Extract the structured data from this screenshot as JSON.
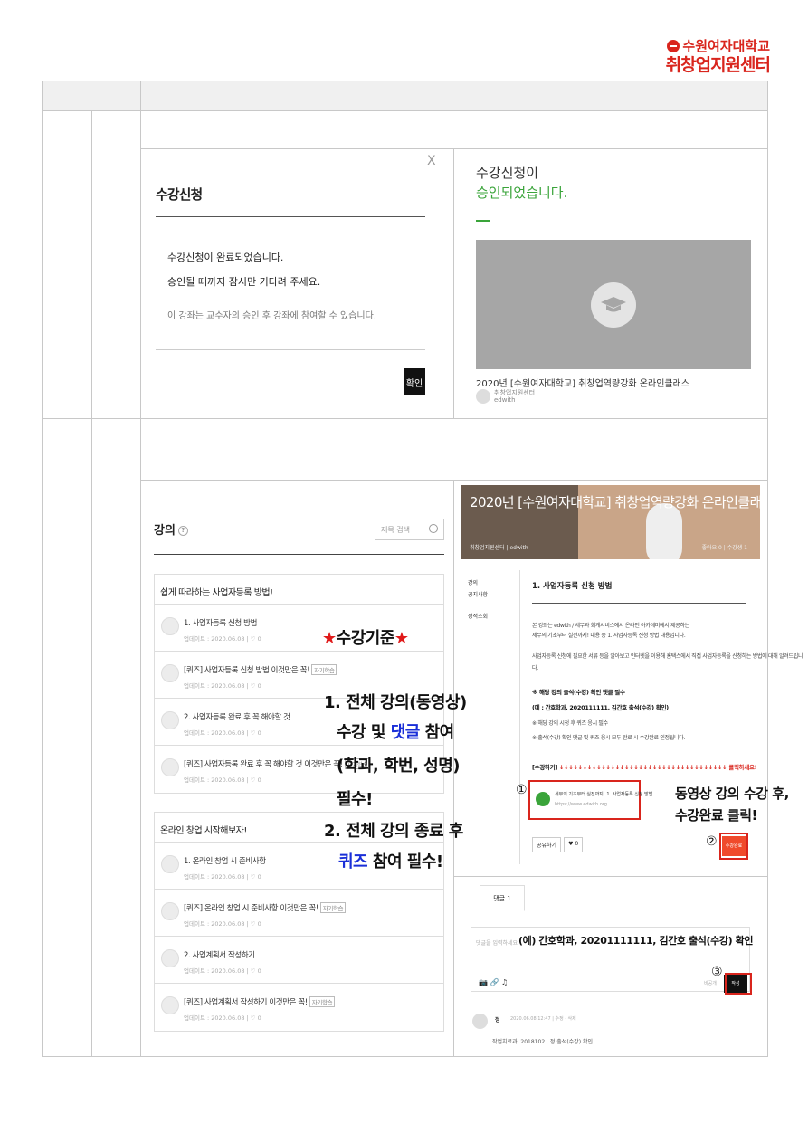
{
  "logo": {
    "line1": "수원여자대학교",
    "line2": "취창업지원센터"
  },
  "panel1_left": {
    "close": "X",
    "title": "수강신청",
    "msg1": "수강신청이 완료되었습니다.",
    "msg2": "승인될 때까지 잠시만 기다려 주세요.",
    "note": "이 강좌는 교수자의 승인 후 강좌에 참여할 수 있습니다.",
    "confirm": "확인"
  },
  "panel1_right": {
    "line1": "수강신청이",
    "line2": "승인되었습니다.",
    "course_title": "2020년 [수원여자대학교] 취창업역량강화 온라인클래스",
    "author": "취창업지원센터",
    "author_sub": "edwith"
  },
  "lectures": {
    "heading": "강의",
    "help": "?",
    "search_placeholder": "제목 검색",
    "sections": [
      {
        "title": "쉽게 따라하는 사업자등록 방법!",
        "items": [
          {
            "title": "1. 사업자등록 신청 방법",
            "tag": "",
            "date": "업데이트 : 2020.06.08  |  ♡ 0"
          },
          {
            "title": "[퀴즈] 사업자등록 신청 방법 이것만은 꼭!",
            "tag": "자기학습",
            "date": "업데이트 : 2020.06.08  |  ♡ 0"
          },
          {
            "title": "2. 사업자등록 완료 후 꼭 해야할 것",
            "tag": "",
            "date": "업데이트 : 2020.06.08  |  ♡ 0"
          },
          {
            "title": "[퀴즈] 사업자등록 완료 후 꼭 해야할 것 이것만은 꼭!",
            "tag": "자기학습",
            "date": "업데이트 : 2020.06.08  |  ♡ 0"
          }
        ]
      },
      {
        "title": "온라인 창업 시작해보자!",
        "items": [
          {
            "title": "1. 온라인 창업 시 준비사항",
            "tag": "",
            "date": "업데이트 : 2020.06.08  |  ♡ 0"
          },
          {
            "title": "[퀴즈] 온라인 창업 시 준비사항 이것만은 꼭!",
            "tag": "자기학습",
            "date": "업데이트 : 2020.06.08  |  ♡ 0"
          },
          {
            "title": "2. 사업계획서 작성하기",
            "tag": "",
            "date": "업데이트 : 2020.06.08  |  ♡ 0"
          },
          {
            "title": "[퀴즈] 사업계획서 작성하기 이것만은 꼭!",
            "tag": "자기학습",
            "date": "업데이트 : 2020.06.08  |  ♡ 0"
          }
        ]
      }
    ]
  },
  "annotation": {
    "star": "★",
    "criteria": "수강기준",
    "l1": "1. 전체 강의(동영상)",
    "l2a": "수강 및 ",
    "l2b": "댓글",
    "l2c": " 참여",
    "l3": "(학과, 학번, 성명)",
    "l4": "필수!",
    "l5": "2. 전체 강의 종료 후",
    "l6a": "퀴즈",
    "l6b": " 참여 필수!",
    "right1": "동영상 강의 수강 후,",
    "right2": "수강완료 클릭!",
    "n1": "①",
    "n2": "②",
    "n3": "③"
  },
  "course_page": {
    "banner_title": "2020년 [수원여자대학교] 취창업역량강화 온라인클래스",
    "banner_meta": "취창업지원센터 | edwith",
    "banner_right": "좋아요 0 | 수강생 1",
    "nav": [
      "강의",
      "공지사항",
      "성적조회"
    ],
    "lesson_title": "1. 사업자등록 신청 방법",
    "p1": "본 강좌는 edwith / 세무와 회계서비스에서 온라인 아카데미에서 제공하는",
    "p2": "세무의 기초부터 실전까지! 내용 중 1. 사업자등록 신청 방법 내용입니다.",
    "p3": "사업자등록 신청에 필요한 서류 등을 알아보고 인터넷을 이용해 홈택스에서 직접 사업자등록을 신청하는 방법에 대해 알려드립니",
    "p4": "다.",
    "r1": "※ 해당 강의 출석(수강) 확인 댓글 필수",
    "r2": "(예 : 간호학과, 2020111111, 김간호 출석(수강) 확인)",
    "r3": "※ 해당 강의 시청 후 퀴즈 응시 필수",
    "r4": "※ 출석(수강) 확인 댓글 및 퀴즈 응시 모두 완료 시 수강완료 인정됩니다.",
    "watch_label": "[수강하기]",
    "watch_arrows": "↓↓↓↓↓↓↓↓↓↓↓↓↓↓↓↓↓↓↓↓↓↓↓↓↓↓↓↓↓↓↓↓↓↓↓↓",
    "watch_click": "클릭하세요!",
    "link_title": "세무의 기초부터 실전까지! 1. 사업자등록 신청 방법",
    "link_url": "https://www.edwith.org",
    "share": "공유하기",
    "like": "♥ 0",
    "complete": "수강완료",
    "comment_tab": "댓글 1",
    "comment_placeholder": "댓글을 입력하세요",
    "comment_value": "(예) 간호학과, 20201111111, 김간호 출석(수강) 확인",
    "tools": "📷  🔗  ♫",
    "private": "비공개",
    "submit": "작성",
    "comment_name": "정",
    "comment_time": "2020.06.08 12:47 |  수정  ·  삭제",
    "comment_text": "작업치료과, 2018102      , 정      출석(수강) 확인"
  }
}
